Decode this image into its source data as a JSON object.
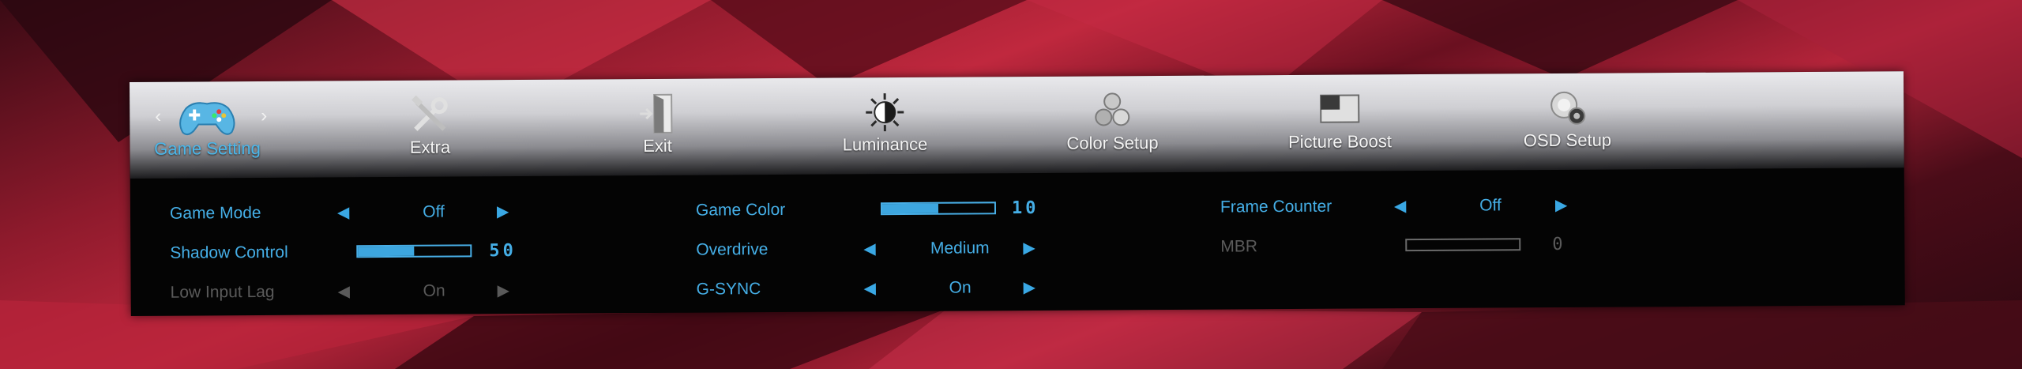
{
  "tabs": [
    {
      "label": "Game Setting",
      "icon": "gamepad-icon",
      "active": true
    },
    {
      "label": "Extra",
      "icon": "tools-icon",
      "active": false
    },
    {
      "label": "Exit",
      "icon": "exit-door-icon",
      "active": false
    },
    {
      "label": "Luminance",
      "icon": "brightness-icon",
      "active": false
    },
    {
      "label": "Color Setup",
      "icon": "color-setup-icon",
      "active": false
    },
    {
      "label": "Picture Boost",
      "icon": "picture-boost-icon",
      "active": false
    },
    {
      "label": "OSD Setup",
      "icon": "osd-setup-icon",
      "active": false
    }
  ],
  "nav": {
    "prev": "‹",
    "next": "›"
  },
  "settings": {
    "game_mode": {
      "label": "Game Mode",
      "value": "Off"
    },
    "shadow_control": {
      "label": "Shadow Control",
      "value": "50",
      "level": 0.5
    },
    "low_input_lag": {
      "label": "Low Input Lag",
      "value": "On"
    },
    "game_color": {
      "label": "Game Color",
      "value": "10",
      "level": 0.5
    },
    "overdrive": {
      "label": "Overdrive",
      "value": "Medium"
    },
    "gsync": {
      "label": "G-SYNC",
      "value": "On"
    },
    "frame_counter": {
      "label": "Frame Counter",
      "value": "Off"
    },
    "mbr": {
      "label": "MBR",
      "value": "0",
      "level": 0
    }
  },
  "arrows": {
    "left": "◀",
    "right": "▶"
  },
  "colors": {
    "accent": "#45aee6",
    "disabled": "#5a5a5a",
    "panel": "#040404"
  }
}
